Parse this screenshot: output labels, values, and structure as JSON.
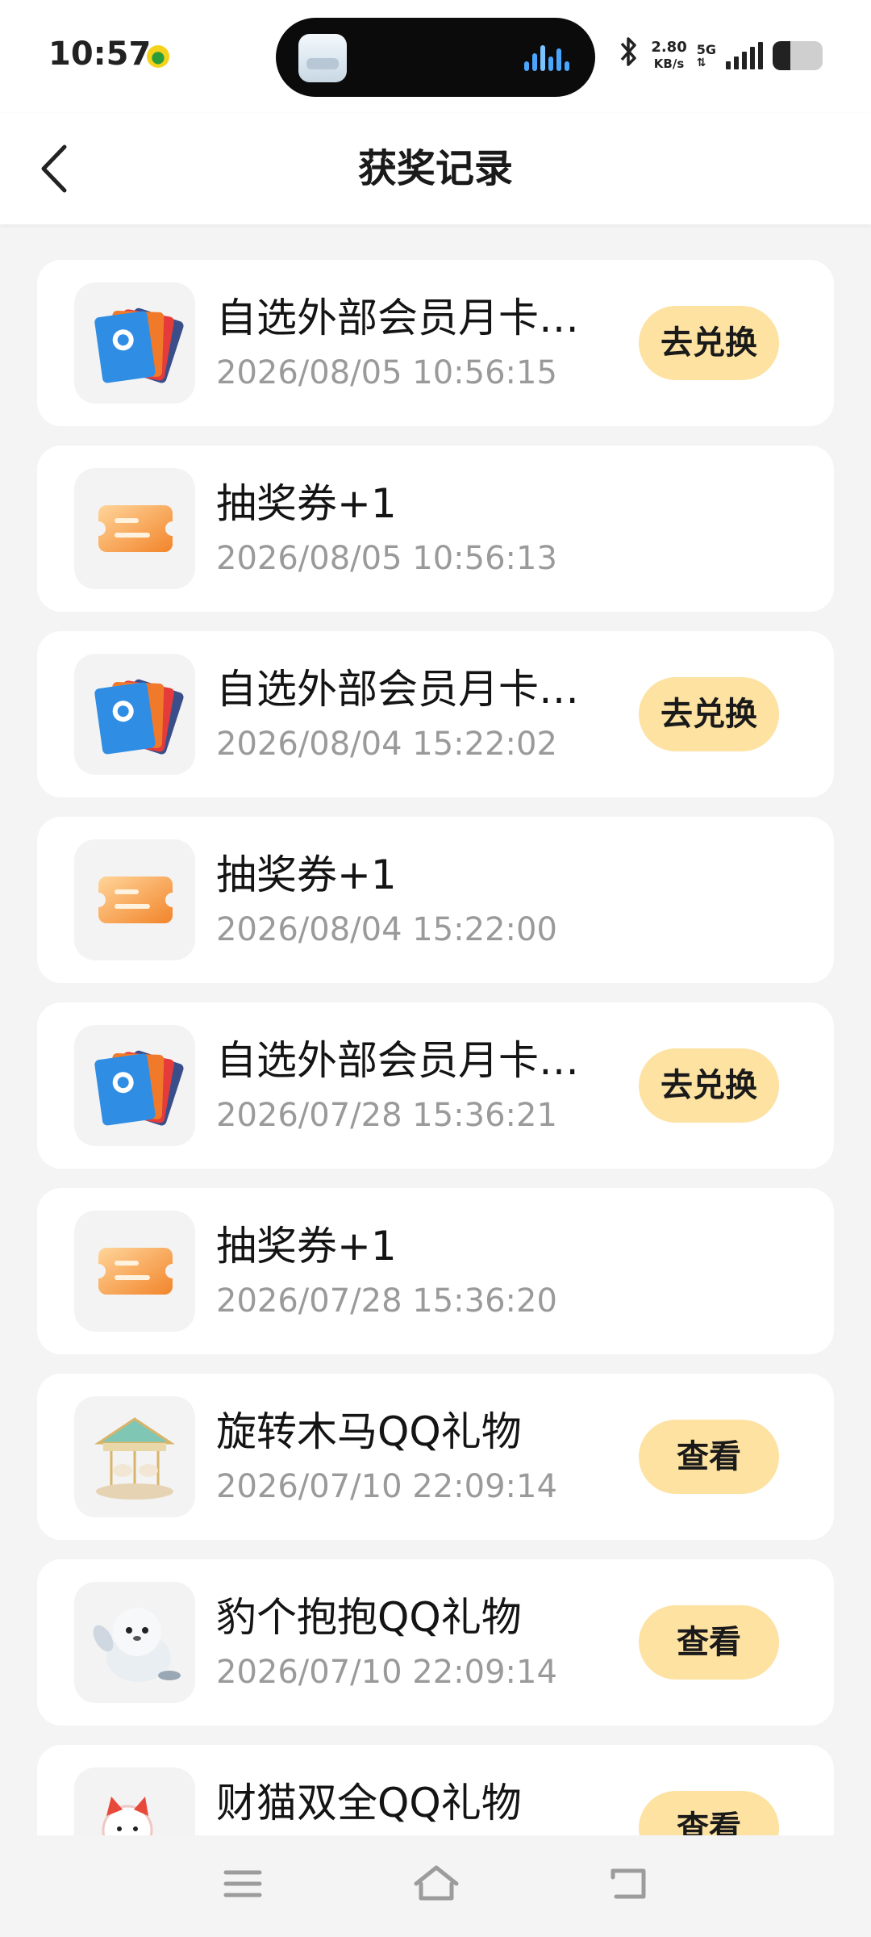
{
  "status_bar": {
    "time": "10:57",
    "speed_value": "2.80",
    "speed_unit": "KB/s",
    "network": "5G",
    "battery_level": 0.35,
    "bluetooth_icon": "bluetooth-icon"
  },
  "header": {
    "title": "获奖记录",
    "back_icon": "chevron-left-icon"
  },
  "records": [
    {
      "name": "自选外部会员月卡…",
      "date": "2026/08/05 10:56:15",
      "action": "去兑换",
      "thumb": "membership-cards"
    },
    {
      "name": "抽奖券+1",
      "date": "2026/08/05 10:56:13",
      "action": "",
      "thumb": "lottery-ticket"
    },
    {
      "name": "自选外部会员月卡…",
      "date": "2026/08/04 15:22:02",
      "action": "去兑换",
      "thumb": "membership-cards"
    },
    {
      "name": "抽奖券+1",
      "date": "2026/08/04 15:22:00",
      "action": "",
      "thumb": "lottery-ticket"
    },
    {
      "name": "自选外部会员月卡…",
      "date": "2026/07/28 15:36:21",
      "action": "去兑换",
      "thumb": "membership-cards"
    },
    {
      "name": "抽奖券+1",
      "date": "2026/07/28 15:36:20",
      "action": "",
      "thumb": "lottery-ticket"
    },
    {
      "name": "旋转木马QQ礼物",
      "date": "2026/07/10 22:09:14",
      "action": "查看",
      "thumb": "carousel"
    },
    {
      "name": "豹个抱抱QQ礼物",
      "date": "2026/07/10 22:09:14",
      "action": "查看",
      "thumb": "seal"
    },
    {
      "name": "财猫双全QQ礼物",
      "date": "",
      "action": "查看",
      "thumb": "lucky-cat"
    }
  ],
  "nav": {
    "menu_icon": "menu-icon",
    "home_icon": "home-icon",
    "back_icon": "back-arrow-icon"
  },
  "colors": {
    "accent_button": "#fde2a2",
    "background": "#f4f4f4",
    "date_text": "#9a9a9a"
  }
}
